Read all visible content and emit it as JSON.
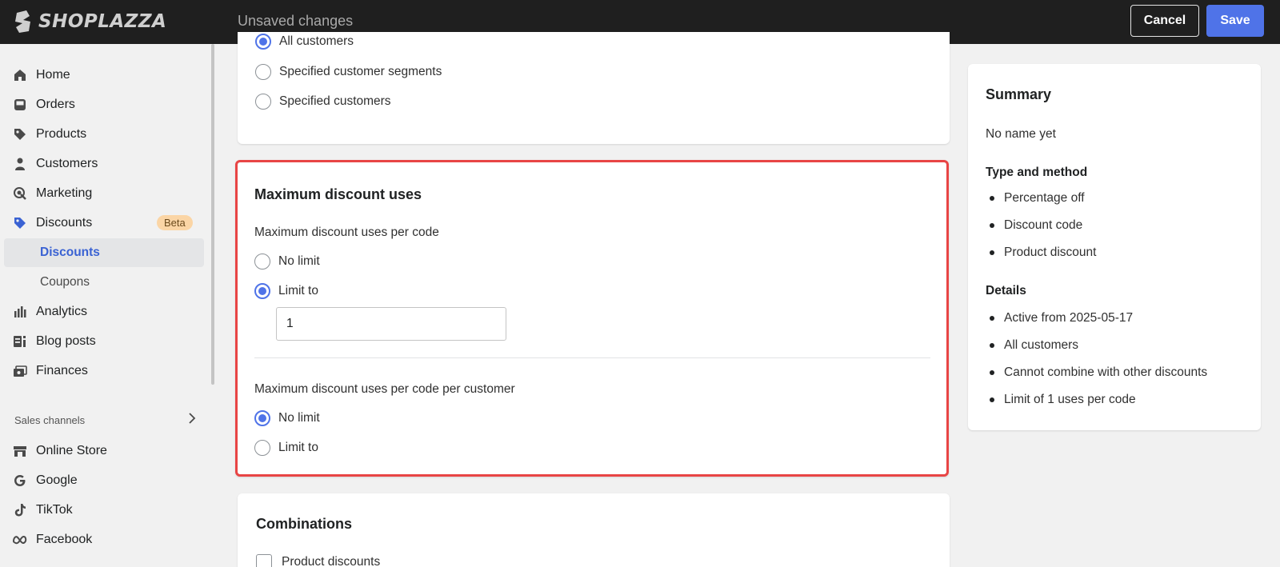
{
  "topbar": {
    "logo_text": "SHOPLAZZA",
    "status": "Unsaved changes",
    "cancel_label": "Cancel",
    "save_label": "Save"
  },
  "sidebar": {
    "items": [
      {
        "label": "Home",
        "icon": "home-icon"
      },
      {
        "label": "Orders",
        "icon": "inbox-icon"
      },
      {
        "label": "Products",
        "icon": "tag-icon"
      },
      {
        "label": "Customers",
        "icon": "person-icon"
      },
      {
        "label": "Marketing",
        "icon": "target-icon"
      },
      {
        "label": "Discounts",
        "icon": "discount-tag-icon",
        "badge": "Beta"
      }
    ],
    "sub_items": [
      {
        "label": "Discounts",
        "active": true
      },
      {
        "label": "Coupons",
        "active": false
      }
    ],
    "items_after": [
      {
        "label": "Analytics",
        "icon": "bar-chart-icon"
      },
      {
        "label": "Blog posts",
        "icon": "blog-icon"
      },
      {
        "label": "Finances",
        "icon": "finance-icon"
      }
    ],
    "sales_channels_label": "Sales channels",
    "channels": [
      {
        "label": "Online Store",
        "icon": "store-icon"
      },
      {
        "label": "Google",
        "icon": "google-icon"
      },
      {
        "label": "TikTok",
        "icon": "tiktok-icon"
      },
      {
        "label": "Facebook",
        "icon": "meta-icon"
      }
    ]
  },
  "eligibility": {
    "options": [
      "All customers",
      "Specified customer segments",
      "Specified customers"
    ],
    "selected": 0
  },
  "max_uses": {
    "title": "Maximum discount uses",
    "per_code_label": "Maximum discount uses per code",
    "per_code_options": [
      "No limit",
      "Limit to"
    ],
    "per_code_selected": 1,
    "per_code_value": "1",
    "per_customer_label": "Maximum discount uses per code per customer",
    "per_customer_options": [
      "No limit",
      "Limit to"
    ],
    "per_customer_selected": 0
  },
  "combinations": {
    "title": "Combinations",
    "options": [
      "Product discounts"
    ]
  },
  "summary": {
    "title": "Summary",
    "name": "No name yet",
    "type_heading": "Type and method",
    "type_items": [
      "Percentage off",
      "Discount code",
      "Product discount"
    ],
    "details_heading": "Details",
    "details_items": [
      "Active from 2025-05-17",
      "All customers",
      "Cannot combine with other discounts",
      "Limit of 1 uses per code"
    ]
  },
  "colors": {
    "topbar_bg": "#1f1f1f",
    "accent": "#4f73e8",
    "highlight_border": "#e84545",
    "badge_bg": "#fbd5a5"
  }
}
